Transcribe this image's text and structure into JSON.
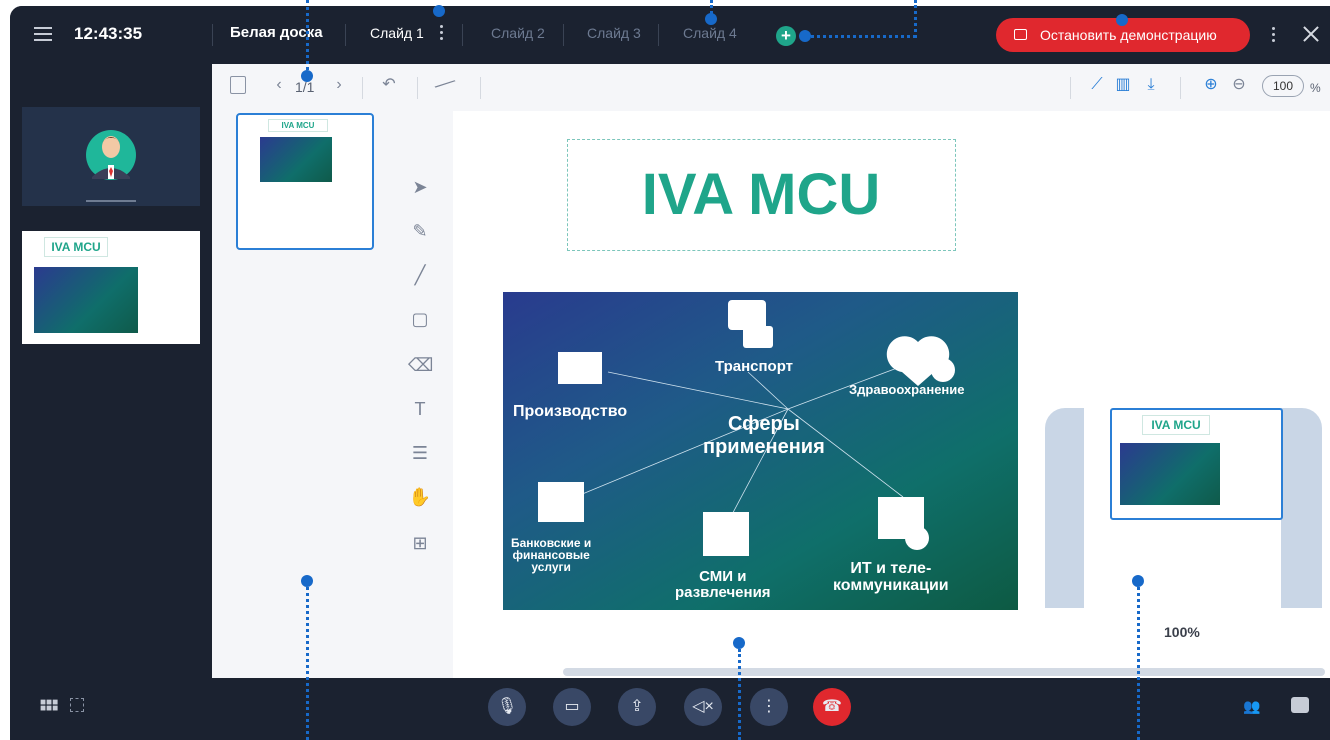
{
  "topbar": {
    "clock": "12:43:35",
    "board_title": "Белая доска",
    "tabs": [
      {
        "label": "Слайд 1",
        "active": true
      },
      {
        "label": "Слайд 2",
        "active": false
      },
      {
        "label": "Слайд 3",
        "active": false
      },
      {
        "label": "Слайд 4",
        "active": false
      }
    ],
    "add_tab": "+",
    "stop_label": "Остановить демонстрацию"
  },
  "toolbar": {
    "page_counter": "1/1",
    "zoom_value": "100",
    "zoom_unit": "%"
  },
  "thumbnail": {
    "title": "IVA MCU"
  },
  "canvas": {
    "title": "IVA MCU",
    "slide": {
      "center": "Сферы\nприменения",
      "items": [
        "Транспорт",
        "Производство",
        "Здравоохранение",
        "Банковские и\nфинансовые\nуслуги",
        "СМИ и\nразвлечения",
        "ИТ и теле-\nкоммуникации"
      ]
    },
    "minimap": {
      "title": "IVA MCU",
      "zoom": "100%"
    }
  },
  "side": {
    "share_title": "IVA MCU"
  },
  "colors": {
    "brand": "#1fa58a",
    "danger": "#e0282e",
    "accent": "#2b7fd6",
    "bg_dark": "#1b2230"
  }
}
